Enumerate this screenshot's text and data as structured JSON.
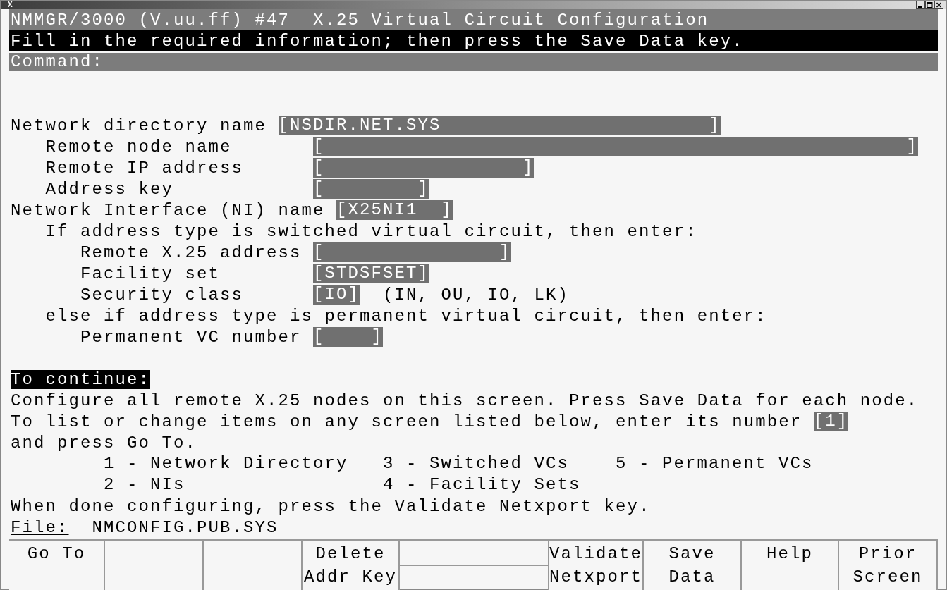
{
  "window": {
    "title_icon": "X"
  },
  "header": {
    "title": "NMMGR/3000 (V.uu.ff) #47  X.25 Virtual Circuit Configuration",
    "message": "Fill in the required information; then press the Save Data key.",
    "command_label": "Command:"
  },
  "form": [
    {
      "kind": "field",
      "label": "Network directory name",
      "value": "[NSDIR.NET.SYS                       ]",
      "children": [
        {
          "kind": "field",
          "label": "Remote node name",
          "value": "[                                                  ]"
        },
        {
          "kind": "field",
          "label": "Remote IP address",
          "value": "[                 ]"
        },
        {
          "kind": "field",
          "label": "Address key",
          "value": "[        ]"
        }
      ]
    },
    {
      "kind": "field",
      "label": "Network Interface (NI) name",
      "value": "[X25NI1  ]",
      "children": [
        {
          "kind": "text",
          "text": "If address type is switched virtual circuit, then enter:",
          "children": [
            {
              "kind": "field",
              "label": "Remote X.25 address",
              "value": "[               ]"
            },
            {
              "kind": "field",
              "label": "Facility set",
              "value": "[STDSFSET]"
            },
            {
              "kind": "field",
              "label": "Security class",
              "value": "[IO]",
              "hint": "(IN, OU, IO, LK)"
            }
          ]
        },
        {
          "kind": "text",
          "text": "else if address type is permanent virtual circuit, then enter:",
          "children": [
            {
              "kind": "field",
              "label": "Permanent VC number",
              "value": "[    ]"
            }
          ]
        }
      ]
    }
  ],
  "continue": {
    "heading": "To continue:",
    "lines": [
      {
        "text": "Configure all remote X.25 nodes on this screen. Press Save Data for each node."
      },
      {
        "text": "To list or change items on any screen listed below, enter its number",
        "field": "[1]"
      },
      {
        "text": "and press Go To."
      }
    ],
    "menu": [
      "1 - Network Directory",
      "3 - Switched VCs",
      "5 - Permanent VCs",
      "2 - NIs",
      "4 - Facility Sets"
    ],
    "note": "When done configuring, press the Validate Netxport key."
  },
  "file": {
    "label": "File:",
    "value": "NMCONFIG.PUB.SYS"
  },
  "function_keys": [
    {
      "kind": "key",
      "lines": [
        "Go To"
      ]
    },
    {
      "kind": "key"
    },
    {
      "kind": "key"
    },
    {
      "kind": "key",
      "lines": [
        "Delete",
        "Addr Key"
      ]
    },
    {
      "kind": "split"
    },
    {
      "kind": "key",
      "lines": [
        "Validate",
        "Netxport"
      ]
    },
    {
      "kind": "key",
      "lines": [
        "Save",
        "Data"
      ]
    },
    {
      "kind": "key",
      "lines": [
        "Help"
      ]
    },
    {
      "kind": "key",
      "lines": [
        "Prior",
        "Screen"
      ]
    }
  ]
}
